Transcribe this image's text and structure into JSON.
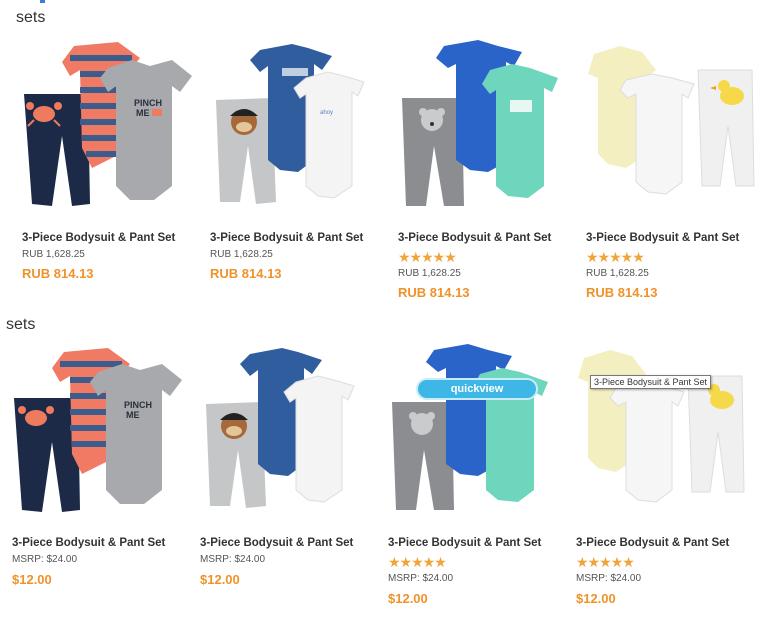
{
  "sections": [
    {
      "heading": "sets",
      "products": [
        {
          "name": "3-Piece Bodysuit & Pant Set",
          "rating": "",
          "orig_price": "RUB 1,628.25",
          "price": "RUB 814.13",
          "image_icon": "crab-outfit-icon"
        },
        {
          "name": "3-Piece Bodysuit & Pant Set",
          "rating": "",
          "orig_price": "RUB 1,628.25",
          "price": "RUB 814.13",
          "image_icon": "pirate-monkey-outfit-icon"
        },
        {
          "name": "3-Piece Bodysuit & Pant Set",
          "rating": "★★★★★",
          "orig_price": "RUB 1,628.25",
          "price": "RUB 814.13",
          "image_icon": "bear-outfit-icon"
        },
        {
          "name": "3-Piece Bodysuit & Pant Set",
          "rating": "★★★★★",
          "orig_price": "RUB 1,628.25",
          "price": "RUB 814.13",
          "image_icon": "duck-outfit-icon"
        }
      ]
    },
    {
      "heading": "sets",
      "products": [
        {
          "name": "3-Piece Bodysuit & Pant Set",
          "rating": "",
          "orig_price": "MSRP: $24.00",
          "price": "$12.00",
          "image_icon": "crab-outfit-icon"
        },
        {
          "name": "3-Piece Bodysuit & Pant Set",
          "rating": "",
          "orig_price": "MSRP: $24.00",
          "price": "$12.00",
          "image_icon": "pirate-monkey-outfit-icon"
        },
        {
          "name": "3-Piece Bodysuit & Pant Set",
          "rating": "★★★★★",
          "orig_price": "MSRP: $24.00",
          "price": "$12.00",
          "image_icon": "bear-outfit-icon"
        },
        {
          "name": "3-Piece Bodysuit & Pant Set",
          "rating": "★★★★★",
          "orig_price": "MSRP: $24.00",
          "price": "$12.00",
          "image_icon": "duck-outfit-icon"
        }
      ]
    }
  ],
  "quickview_label": "quickview",
  "tooltip_text": "3-Piece Bodysuit & Pant Set",
  "colors": {
    "accent_price": "#f0922a",
    "stars": "#f0a43a",
    "quickview_bg": "#3eb6e6"
  }
}
